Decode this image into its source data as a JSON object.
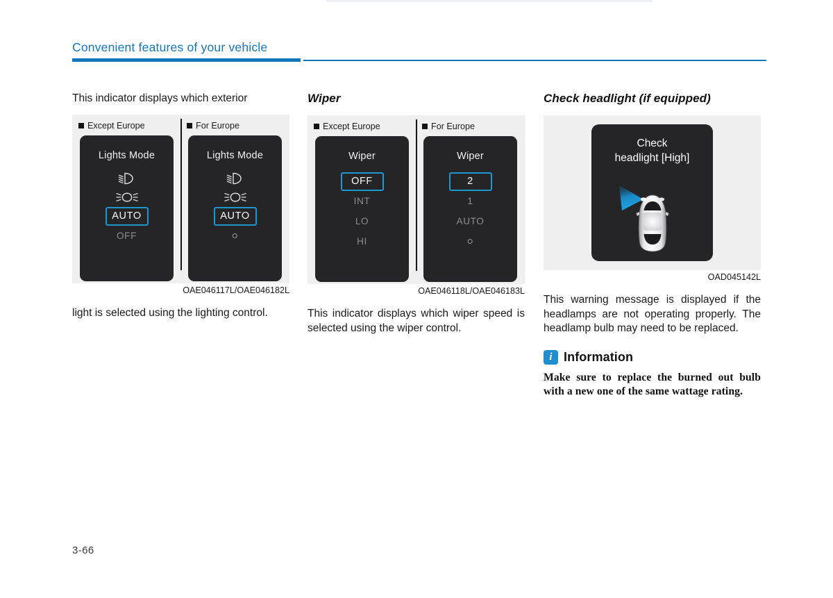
{
  "header": {
    "title": "Convenient features of your vehicle",
    "accent_color": "#1577bb"
  },
  "columns": {
    "lights": {
      "intro_text": "This indicator displays which exterior",
      "figure": {
        "label_left": "Except Europe",
        "label_right": "For Europe",
        "caption": "OAE046117L/OAE046182L",
        "panel_left": {
          "title": "Lights Mode",
          "icons": [
            "headlight-low-beam-icon",
            "position-lamp-icon"
          ],
          "items": [
            {
              "label": "AUTO",
              "state": "selected"
            },
            {
              "label": "OFF",
              "state": "dim"
            }
          ]
        },
        "panel_right": {
          "title": "Lights Mode",
          "icons": [
            "headlight-low-beam-icon",
            "position-lamp-icon"
          ],
          "items": [
            {
              "label": "AUTO",
              "state": "selected"
            },
            {
              "label": "○",
              "state": "bright"
            }
          ]
        }
      },
      "body_text": "light is selected using the lighting control."
    },
    "wiper": {
      "heading": "Wiper",
      "figure": {
        "label_left": "Except Europe",
        "label_right": "For Europe",
        "caption": "OAE046118L/OAE046183L",
        "panel_left": {
          "title": "Wiper",
          "items": [
            {
              "label": "OFF",
              "state": "selected"
            },
            {
              "label": "INT",
              "state": "dim"
            },
            {
              "label": "LO",
              "state": "dim"
            },
            {
              "label": "HI",
              "state": "dim"
            }
          ]
        },
        "panel_right": {
          "title": "Wiper",
          "items": [
            {
              "label": "2",
              "state": "selected"
            },
            {
              "label": "1",
              "state": "dim"
            },
            {
              "label": "AUTO",
              "state": "dim"
            },
            {
              "label": "○",
              "state": "bright"
            }
          ]
        }
      },
      "body_text": "This indicator displays which wiper speed is selected using the wiper control."
    },
    "check_headlight": {
      "heading": "Check headlight (if equipped)",
      "figure": {
        "caption": "OAD045142L",
        "panel": {
          "title_line1": "Check",
          "title_line2": "headlight [High]",
          "artwork": "car-top-view-with-headlight-beam",
          "beam_color": "#1e9bd7"
        }
      },
      "body_text": "This warning message is displayed if the headlamps are not operating properly. The headlamp bulb may need to be replaced.",
      "information": {
        "icon": "info-icon",
        "icon_letter": "i",
        "title": "Information",
        "text": "Make sure to replace the burned out bulb with a new one of the same wattage rating."
      }
    }
  },
  "footer": {
    "page_number": "3-66"
  }
}
